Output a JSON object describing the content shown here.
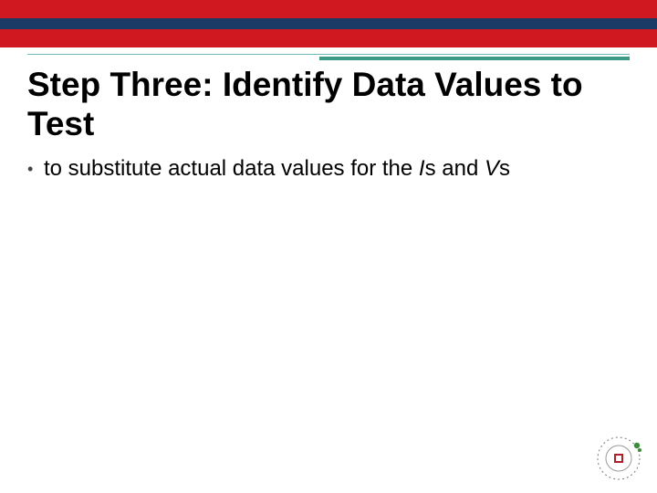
{
  "colors": {
    "top_red": "#cf1820",
    "top_navy": "#1a3b66",
    "divider_main": "#3d9a87",
    "divider_thin": "#6db8bd"
  },
  "title": "Step Three: Identify Data Values to Test",
  "bullets": [
    {
      "prefix": "to substitute actual data values for the ",
      "ital1": "I",
      "mid": "s and ",
      "ital2": "V",
      "suffix": "s"
    }
  ],
  "logo": {
    "name": "university-seal"
  }
}
